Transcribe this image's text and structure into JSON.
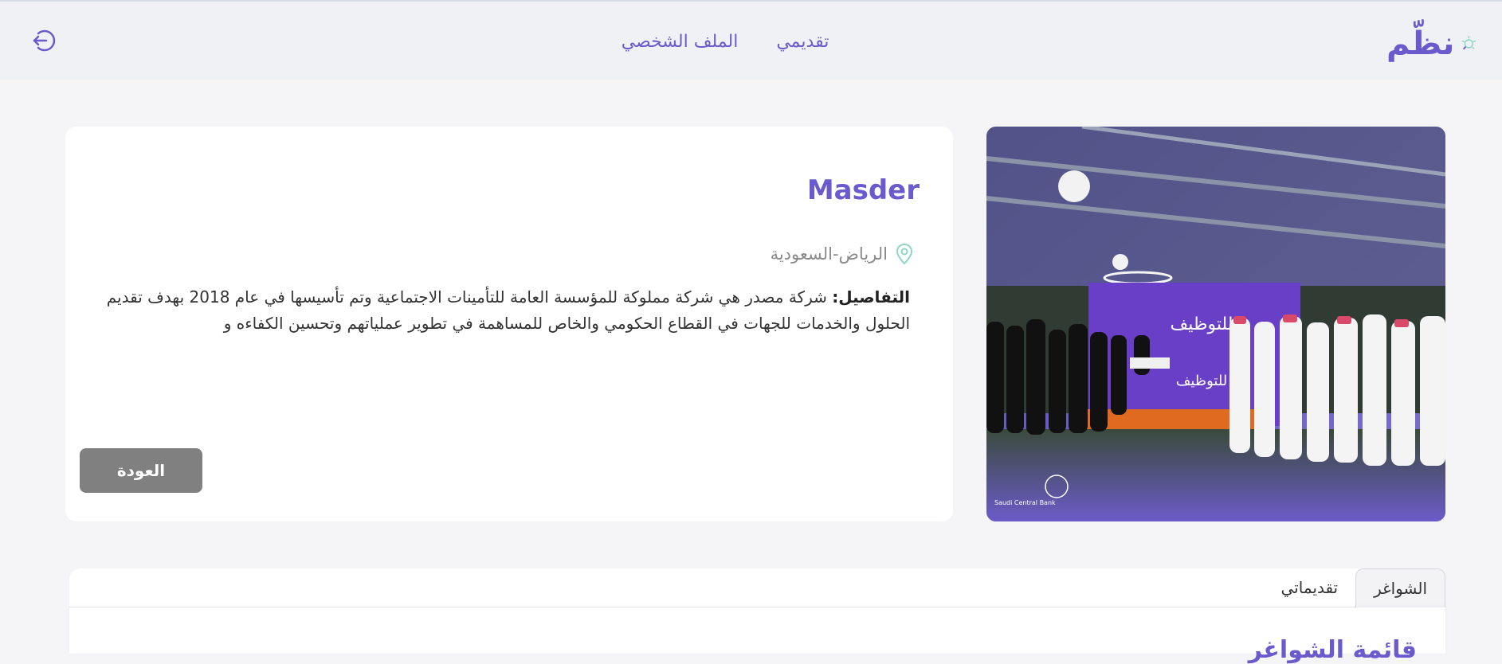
{
  "brand": {
    "logo_text": "نظّم",
    "accent": "#6a5acd",
    "icon_accent": "#8fd6c8"
  },
  "nav": {
    "items": [
      {
        "label": "تقديمي"
      },
      {
        "label": "الملف الشخصي"
      }
    ],
    "logout_icon": "logout-icon"
  },
  "company": {
    "name": "Masder",
    "location": "الرياض-السعودية",
    "details_label": "التفاصيل:",
    "details_text": " شركة مصدر هي شركة مملوكة للمؤسسة العامة للتأمينات الاجتماعية وتم تأسيسها في عام 2018 بهدف تقديم الحلول والخدمات للجهات في القطاع الحكومي والخاص للمساهمة في تطوير عملياتهم وتحسين الكفاءه و",
    "back_label": "العودة"
  },
  "hero": {
    "banner_text_1": "للتوظيف",
    "banner_text_2": "للتوظيف",
    "footer_left": "Saudi Central Bank"
  },
  "tabs": {
    "items": [
      {
        "label": "الشواغر",
        "active": true
      },
      {
        "label": "تقديماتي",
        "active": false
      }
    ]
  },
  "panel": {
    "title": "قائمة الشواغر"
  }
}
